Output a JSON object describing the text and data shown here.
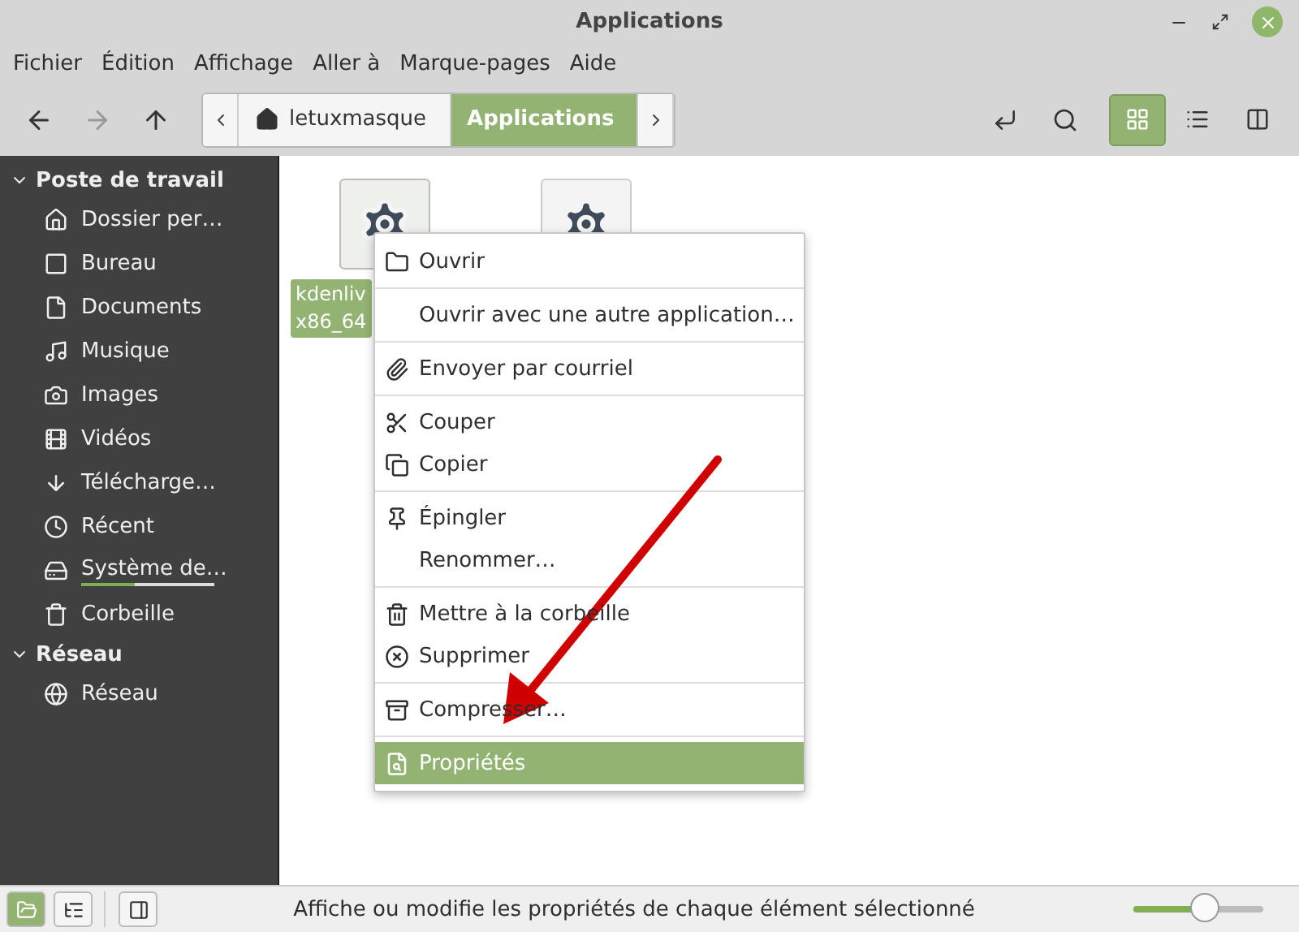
{
  "window": {
    "title": "Applications"
  },
  "menubar": [
    "Fichier",
    "Édition",
    "Affichage",
    "Aller à",
    "Marque-pages",
    "Aide"
  ],
  "breadcrumbs": [
    {
      "label": "letuxmasque",
      "selected": false
    },
    {
      "label": "Applications",
      "selected": true
    }
  ],
  "view_buttons": [
    {
      "selected": true
    },
    {
      "selected": false
    },
    {
      "selected": false
    }
  ],
  "sidebar": [
    {
      "heading": "Poste de travail",
      "expanded": true,
      "items": [
        {
          "label": "Dossier per…"
        },
        {
          "label": "Bureau"
        },
        {
          "label": "Documents"
        },
        {
          "label": "Musique"
        },
        {
          "label": "Images"
        },
        {
          "label": "Vidéos"
        },
        {
          "label": "Télécharge…"
        },
        {
          "label": "Récent"
        },
        {
          "label": "Système de…",
          "level": 0.4
        },
        {
          "label": "Corbeille"
        }
      ]
    },
    {
      "heading": "Réseau",
      "expanded": true,
      "items": [
        {
          "label": "Réseau"
        }
      ]
    }
  ],
  "files": [
    {
      "kind": "executable",
      "selected": true,
      "label_lines": [
        "kdenliv",
        "x86_64"
      ]
    },
    {
      "kind": "executable"
    }
  ],
  "context_menu": [
    [
      {
        "label": "Ouvrir",
        "selected": false
      }
    ],
    [
      {
        "label": "Ouvrir avec une autre application…",
        "selected": false
      }
    ],
    [
      {
        "label": "Envoyer par courriel",
        "selected": false
      }
    ],
    [
      {
        "label": "Couper",
        "selected": false
      },
      {
        "label": "Copier",
        "selected": false
      }
    ],
    [
      {
        "label": "Épingler",
        "selected": false
      },
      {
        "label": "Renommer…",
        "selected": false
      }
    ],
    [
      {
        "label": "Mettre à la corbeille",
        "selected": false
      },
      {
        "label": "Supprimer",
        "selected": false
      }
    ],
    [
      {
        "label": "Compresser…",
        "selected": false
      }
    ],
    [
      {
        "label": "Propriétés",
        "selected": true
      }
    ]
  ],
  "status_bar": {
    "text": "Affiche ou modifie les propriétés de chaque élément sélectionné",
    "zoom": {
      "level": 0.55
    }
  }
}
